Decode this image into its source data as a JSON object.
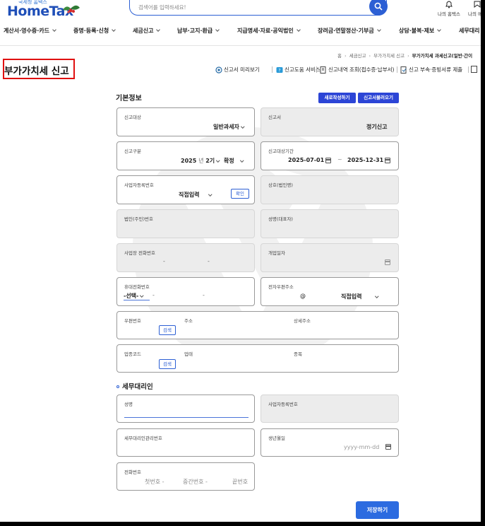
{
  "header": {
    "logo_sub": "국세청 홈택스",
    "logo": "HomeTax",
    "search_placeholder": "검색어를 입력하세요!",
    "top_icons": [
      {
        "name": "bell-icon",
        "label": "나의 홈택스"
      },
      {
        "name": "user-icon",
        "label": "나의 메뉴"
      }
    ]
  },
  "gnb": [
    "계산서·영수증·카드",
    "증명·등록·신청",
    "세금신고",
    "납부·고지·환급",
    "지급명세·자료·공익법인",
    "장려금·연말정산·기부금",
    "상담·불복·제보",
    "세무대리"
  ],
  "breadcrumb": [
    "홈",
    "세금신고",
    "부가가치세 신고",
    "부가가치세 과세신고(일반·간이"
  ],
  "page_title": "부가가치세 신고",
  "quicklinks": [
    {
      "icon": "preview-icon",
      "label": "신고서 미리보기"
    },
    {
      "icon": "help-service-icon",
      "label": "신고도움 서비스"
    },
    {
      "icon": "history-icon",
      "label": "신고내역 조회(접수증·납부서)"
    },
    {
      "icon": "attach-icon",
      "label": "신고 부속·증빙서류 제출"
    }
  ],
  "basic_info": {
    "title": "기본정보",
    "btn_new": "새로작성하기",
    "btn_load": "신고서불러오기",
    "report_target_label": "신고대상",
    "report_target_value": "일반과세자",
    "report_form_label": "신고서",
    "report_form_value": "정기신고",
    "report_type_label": "신고구분",
    "report_year": "2025",
    "report_year_unit": "년",
    "report_period": "2기",
    "report_kind": "확정",
    "period_label": "신고대상기간",
    "period_start": "2025-07-01",
    "period_tilde": "~",
    "period_end": "2025-12-31",
    "brn_label": "사업자등록번호",
    "brn_value": "직접입력",
    "confirm_btn": "확인",
    "company_label": "상호(법인명)",
    "corp_no_label": "법인(주민)번호",
    "rep_name_label": "성명(대표자)",
    "biz_phone_label": "사업장 전화번호",
    "dash": "-",
    "opening_date_label": "개업일자",
    "mobile_label": "휴대전화번호",
    "mobile_select": "-선택-",
    "email_label": "전자우편주소",
    "email_at": "@",
    "email_domain": "직접입력",
    "zip_label": "우편번호",
    "address_label": "주소",
    "detail_address_label": "상세주소",
    "search_btn": "검색",
    "industry_code_label": "업종코드",
    "business_type_label": "업태",
    "category_label": "종목"
  },
  "agent": {
    "title": "세무대리인",
    "name_label": "성명",
    "brn_label": "사업자등록번호",
    "mgmt_no_label": "세무대리인관리번호",
    "birth_label": "생년월일",
    "birth_placeholder": "yyyy-mm-dd",
    "phone_label": "전화번호",
    "phone_first": "첫번호",
    "phone_mid": "중간번호",
    "phone_last": "끝번호"
  },
  "save_button": "저장하기",
  "colors": {
    "brand_blue": "#1f4fb8",
    "button_blue": "#2c45d6",
    "highlight_red": "#e01010"
  }
}
